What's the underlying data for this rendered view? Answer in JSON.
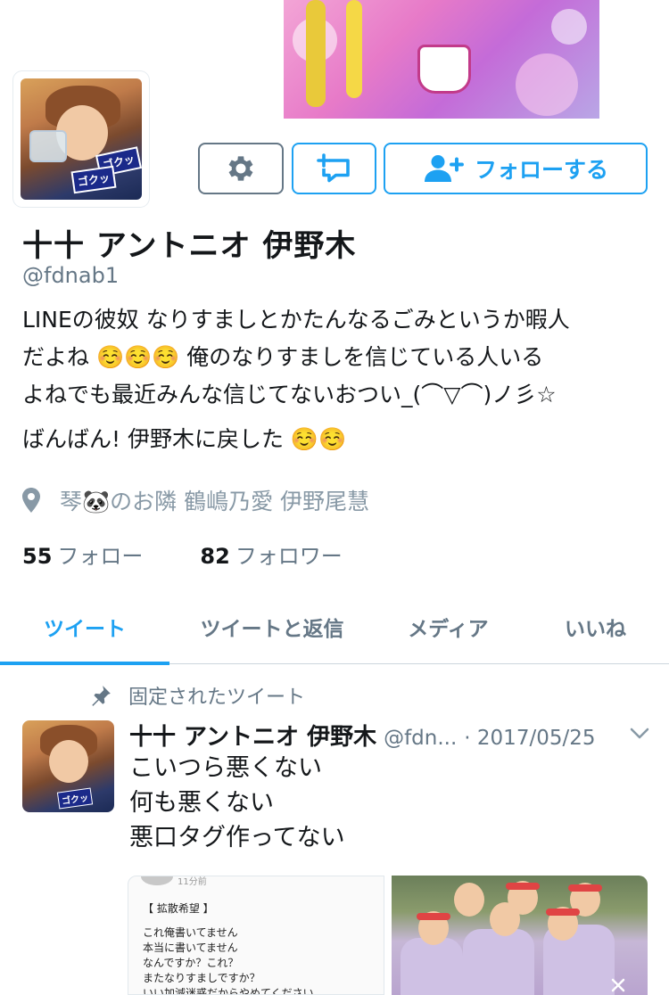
{
  "profile": {
    "name": "十十 アントニオ 伊野木",
    "handle": "@fdnab1",
    "avatar_tag_1": "ゴクッ",
    "avatar_tag_2": "ゴクッ",
    "bio_line_1": "LINEの彼奴 なりすましとかたんなるごみというか暇人",
    "bio_line_2": "だよね ☺️☺️☺️ 俺のなりすましを信じている人いる",
    "bio_line_3": "よねでも最近みんな信じてないおつい_(⌒▽⌒)ノ彡☆",
    "bio_line_4": "ばんばん! 伊野木に戻した ☺️☺️",
    "location": "琴🐼のお隣 鶴嶋乃愛 伊野尾慧",
    "following_count": "55",
    "following_label": "フォロー",
    "followers_count": "82",
    "followers_label": "フォロワー"
  },
  "actions": {
    "follow_label": "フォローする",
    "gear_icon": "gear-icon",
    "list_icon": "add-to-list-icon",
    "follow_icon": "person-add-icon"
  },
  "tabs": [
    {
      "label": "ツイート",
      "active": true
    },
    {
      "label": "ツイートと返信",
      "active": false
    },
    {
      "label": "メディア",
      "active": false
    },
    {
      "label": "いいね",
      "active": false
    }
  ],
  "pinned": {
    "label": "固定されたツイート",
    "icon": "pin-icon"
  },
  "tweet": {
    "name": "十十 アントニオ 伊野木",
    "handle": "@fdn...",
    "date": "· 2017/05/25",
    "avatar_tag": "ゴクッ",
    "lines": [
      "こいつら悪くない",
      "何も悪くない",
      "悪口タグ作ってない"
    ],
    "media_text": {
      "meta": "11分前",
      "title": "【 拡散希望 】",
      "lines": [
        "これ俺書いてません",
        "本当に書いてません",
        "なんですか？これ？",
        "またなりすましですか？",
        "いい加減迷惑だからやめてください。"
      ]
    }
  },
  "colors": {
    "accent": "#1da1f2",
    "text": "#14171a",
    "muted": "#657786"
  }
}
